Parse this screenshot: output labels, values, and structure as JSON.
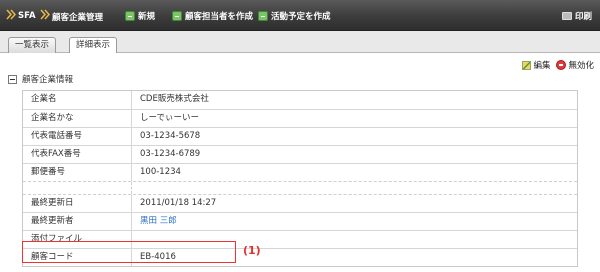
{
  "header": {
    "crumbs": [
      "SFA",
      "顧客企業管理"
    ],
    "toolbar": [
      {
        "label": "新規",
        "icon": "add-icon"
      },
      {
        "label": "顧客担当者を作成",
        "icon": "add-contact-icon"
      },
      {
        "label": "活動予定を作成",
        "icon": "add-activity-icon"
      }
    ],
    "print_label": "印刷"
  },
  "tabs": [
    {
      "label": "一覧表示",
      "active": false
    },
    {
      "label": "詳細表示",
      "active": true
    }
  ],
  "actions": {
    "edit_label": "編集",
    "disable_label": "無効化"
  },
  "section": {
    "title": "顧客企業情報"
  },
  "rows": [
    {
      "label": "企業名",
      "value": "CDE販売株式会社"
    },
    {
      "label": "企業名かな",
      "value": "しーでぃーいー"
    },
    {
      "label": "代表電話番号",
      "value": "03-1234-5678"
    },
    {
      "label": "代表FAX番号",
      "value": "03-1234-6789"
    },
    {
      "label": "郵便番号",
      "value": "100-1234"
    },
    {
      "label": "最終更新日",
      "value": "2011/01/18 14:27"
    },
    {
      "label": "最終更新者",
      "value": "黒田 三郎"
    },
    {
      "label": "添付ファイル",
      "value": ""
    },
    {
      "label": "顧客コード",
      "value": "EB-4016"
    }
  ],
  "annotation": "(1)",
  "colors": {
    "header_bg": "#3c3c3c",
    "highlight": "#ee3333",
    "link": "#2a6cc7"
  }
}
